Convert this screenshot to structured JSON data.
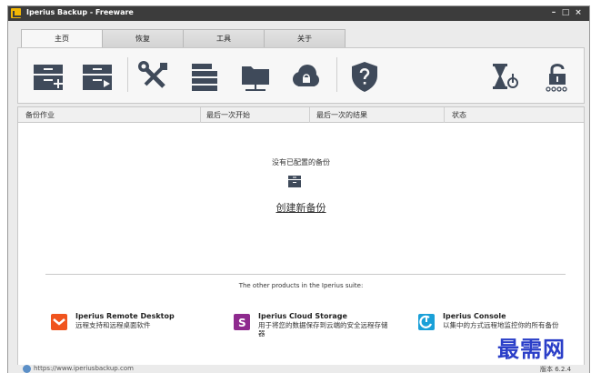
{
  "window": {
    "title": "Iperius Backup - Freeware",
    "controls": {
      "minimize": "–",
      "maximize": "□",
      "close": "×"
    }
  },
  "tabs": [
    {
      "label": "主页",
      "active": true
    },
    {
      "label": "恢复",
      "active": false
    },
    {
      "label": "工具",
      "active": false
    },
    {
      "label": "关于",
      "active": false
    }
  ],
  "toolbar": {
    "accent_color": "#3f4a5a",
    "icons": [
      "new-backup-job-icon",
      "run-backup-job-icon",
      "tools-icon",
      "list-icon",
      "network-folder-icon",
      "cloud-icon",
      "help-shield-icon",
      "scheduler-icon",
      "license-lock-icon"
    ]
  },
  "columns": {
    "job": "备份作业",
    "last_start": "最后一次开始",
    "last_result": "最后一次的结果",
    "status": "状态"
  },
  "main": {
    "empty_message": "没有已配置的备份",
    "create_link": "创建新备份",
    "suite_label": "The other products in the Iperius suite:"
  },
  "products": [
    {
      "name": "Iperius Remote Desktop",
      "desc": "远程支持和远程桌面软件",
      "color": "#f0541e"
    },
    {
      "name": "Iperius Cloud Storage",
      "desc": "用于将您的数据保存到云端的安全远程存储器",
      "color": "#8e2a8e"
    },
    {
      "name": "Iperius Console",
      "desc": "以集中的方式远程地监控你的所有备份",
      "color": "#1aa0d8"
    }
  ],
  "statusbar": {
    "url": "https://www.iperiusbackup.com",
    "version": "版本 6.2.4"
  },
  "watermark": "最需网"
}
